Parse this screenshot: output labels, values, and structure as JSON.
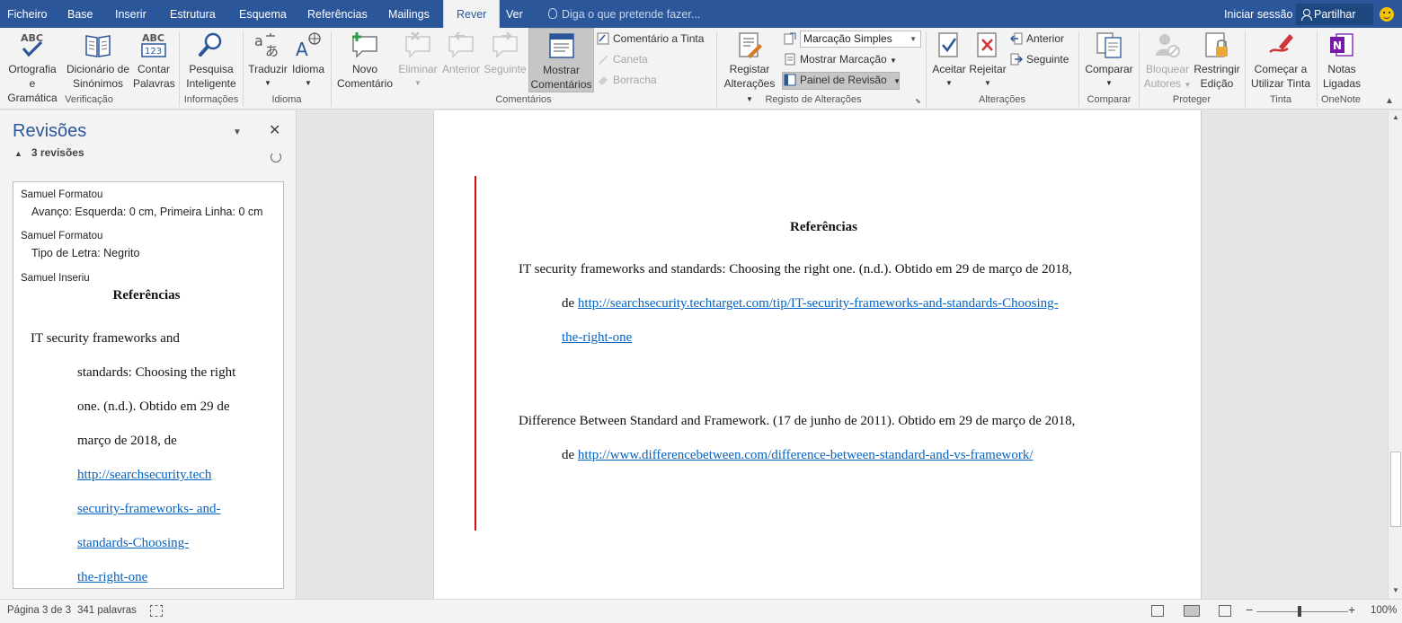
{
  "tabs": {
    "items": [
      "Ficheiro",
      "Base",
      "Inserir",
      "Estrutura",
      "Esquema",
      "Referências",
      "Mailings",
      "Rever",
      "Ver"
    ],
    "active": "Rever",
    "tell_me": "Diga o que pretende fazer...",
    "sign_in": "Iniciar sessão",
    "share": "Partilhar"
  },
  "ribbon": {
    "verificacao": {
      "group": "Verificação",
      "spelling_1": "Ortografia",
      "spelling_2": "e Gramática",
      "thesaurus_1": "Dicionário de",
      "thesaurus_2": "Sinónimos",
      "count_1": "Contar",
      "count_2": "Palavras"
    },
    "informacoes": {
      "group": "Informações",
      "smart_1": "Pesquisa",
      "smart_2": "Inteligente"
    },
    "idioma": {
      "group": "Idioma",
      "translate": "Traduzir",
      "language": "Idioma"
    },
    "comentarios": {
      "group": "Comentários",
      "new_1": "Novo",
      "new_2": "Comentário",
      "delete": "Eliminar",
      "previous": "Anterior",
      "next": "Seguinte",
      "show_1": "Mostrar",
      "show_2": "Comentários",
      "ink": "Comentário a Tinta",
      "pen": "Caneta",
      "eraser": "Borracha"
    },
    "registo": {
      "group": "Registo de Alterações",
      "track_1": "Registar",
      "track_2": "Alterações",
      "markup_select": "Marcação Simples",
      "show_markup": "Mostrar Marcação",
      "reviewing_pane": "Painel de Revisão"
    },
    "alteracoes": {
      "group": "Alterações",
      "accept": "Aceitar",
      "reject": "Rejeitar",
      "previous": "Anterior",
      "next": "Seguinte"
    },
    "comparar": {
      "group": "Comparar",
      "compare": "Comparar"
    },
    "proteger": {
      "group": "Proteger",
      "block_1": "Bloquear",
      "block_2": "Autores",
      "restrict_1": "Restringir",
      "restrict_2": "Edição"
    },
    "tinta": {
      "group": "Tinta",
      "start_1": "Começar a",
      "start_2": "Utilizar Tinta"
    },
    "onenote": {
      "group": "OneNote",
      "notes_1": "Notas",
      "notes_2": "Ligadas"
    }
  },
  "pane": {
    "title": "Revisões",
    "count": "3 revisões",
    "revisions": [
      {
        "author": "Samuel Formatou",
        "detail": "Avanço: Esquerda: 0 cm, Primeira Linha: 0 cm"
      },
      {
        "author": "Samuel Formatou",
        "detail": "Tipo de Letra: Negrito"
      },
      {
        "author": "Samuel Inseriu",
        "detail": ""
      }
    ],
    "inserted_heading": "Referências",
    "inserted_lines": [
      "IT security frameworks and",
      "standards: Choosing the right",
      "one. (n.d.). Obtido em 29 de",
      "março de 2018, de"
    ],
    "inserted_links": [
      "http://searchsecurity.tech",
      "security-frameworks- and-",
      "standards-Choosing-",
      "the-right-one"
    ]
  },
  "document": {
    "heading": "Referências",
    "ref1_line1": "IT security frameworks and standards: Choosing the right one. (n.d.). Obtido em 29 de março de 2018,",
    "ref1_de": "de",
    "ref1_link_a": "http://searchsecurity.techtarget.com/tip/IT-security-frameworks-and-standards-Choosing-",
    "ref1_link_b": "the-right-one",
    "ref2_line1": "Difference Between Standard and Framework. (17 de junho de 2011). Obtido em 29 de março de 2018,",
    "ref2_de": "de",
    "ref2_link": "http://www.differencebetween.com/difference-between-standard-and-vs-framework/"
  },
  "status": {
    "page": "Página 3 de 3",
    "words": "341 palavras",
    "zoom": "100%"
  },
  "colors": {
    "accent": "#2b579a",
    "link": "#0563c1",
    "change_bar": "#d01010"
  }
}
